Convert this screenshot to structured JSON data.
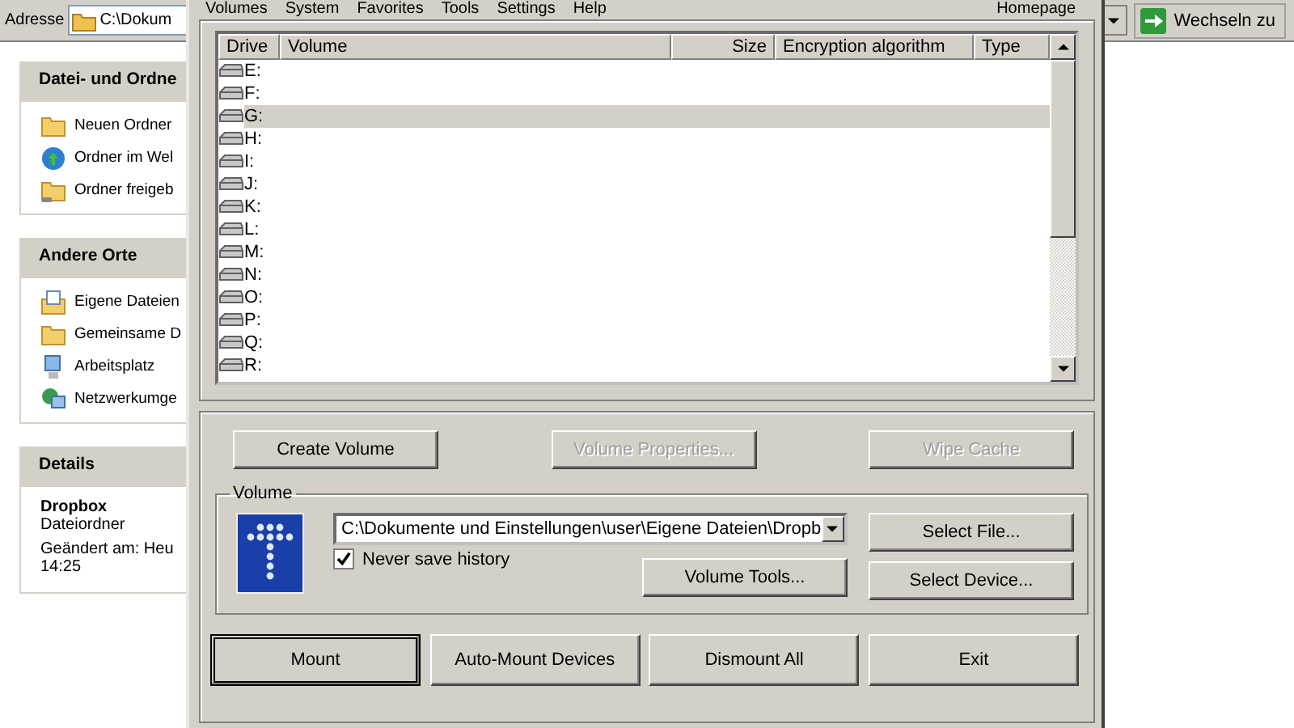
{
  "address_bar": {
    "label": "Adresse",
    "value": "C:\\Dokum",
    "go_button": "Wechseln zu"
  },
  "task_panels": [
    {
      "title": "Datei- und Ordne",
      "items": [
        {
          "label": "Neuen Ordner",
          "kind": "folder-new"
        },
        {
          "label": "Ordner im Wel",
          "kind": "globe"
        },
        {
          "label": "Ordner freigeb",
          "kind": "folder-share"
        }
      ]
    },
    {
      "title": "Andere Orte",
      "items": [
        {
          "label": "Eigene Dateien",
          "kind": "documents"
        },
        {
          "label": "Gemeinsame D",
          "kind": "folder"
        },
        {
          "label": "Arbeitsplatz",
          "kind": "computer"
        },
        {
          "label": "Netzwerkumge",
          "kind": "network"
        }
      ]
    }
  ],
  "details": {
    "title": "Details",
    "name": "Dropbox",
    "type": "Dateiordner",
    "modified": "Geändert am: Heu",
    "time": "14:25"
  },
  "dialog": {
    "menu": [
      "Volumes",
      "System",
      "Favorites",
      "Tools",
      "Settings",
      "Help"
    ],
    "homepage": "Homepage",
    "drive_list": {
      "columns": [
        "Drive",
        "Volume",
        "Size",
        "Encryption algorithm",
        "Type"
      ],
      "rows": [
        {
          "drive": "E:",
          "selected": false
        },
        {
          "drive": "F:",
          "selected": false
        },
        {
          "drive": "G:",
          "selected": true
        },
        {
          "drive": "H:",
          "selected": false
        },
        {
          "drive": "I:",
          "selected": false
        },
        {
          "drive": "J:",
          "selected": false
        },
        {
          "drive": "K:",
          "selected": false
        },
        {
          "drive": "L:",
          "selected": false
        },
        {
          "drive": "M:",
          "selected": false
        },
        {
          "drive": "N:",
          "selected": false
        },
        {
          "drive": "O:",
          "selected": false
        },
        {
          "drive": "P:",
          "selected": false
        },
        {
          "drive": "Q:",
          "selected": false
        },
        {
          "drive": "R:",
          "selected": false
        }
      ]
    },
    "top_buttons": [
      {
        "label": "Create Volume",
        "disabled": false
      },
      {
        "label": "Volume Properties...",
        "disabled": true
      },
      {
        "label": "Wipe Cache",
        "disabled": true
      }
    ],
    "volume": {
      "title": "Volume",
      "path": "C:\\Dokumente und Einstellungen\\user\\Eigene Dateien\\Dropb",
      "never_save_history": {
        "label": "Never save history",
        "checked": true
      },
      "tools_button": "Volume Tools...",
      "select_file": "Select File...",
      "select_device": "Select Device..."
    },
    "bottom_buttons": [
      {
        "label": "Mount",
        "default": true
      },
      {
        "label": "Auto-Mount Devices",
        "default": false
      },
      {
        "label": "Dismount All",
        "default": false
      },
      {
        "label": "Exit",
        "default": false
      }
    ]
  }
}
